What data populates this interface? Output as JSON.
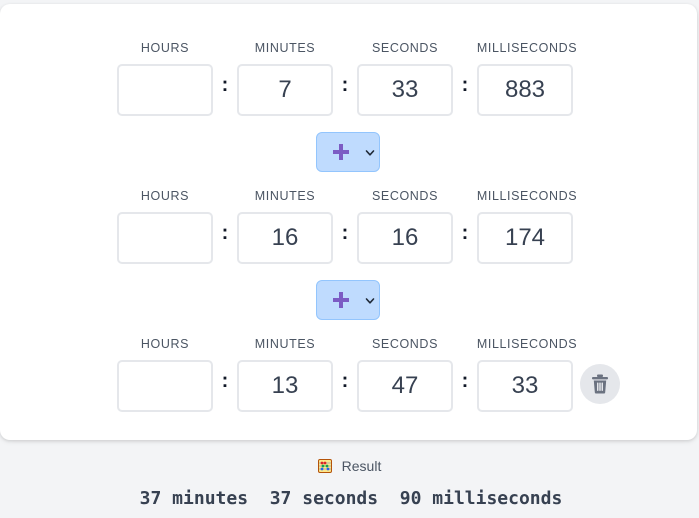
{
  "rows": [
    {
      "labels": {
        "hours": "HOURS",
        "minutes": "MINUTES",
        "seconds": "SECONDS",
        "milliseconds": "MILLISECONDS"
      },
      "values": {
        "hours": "",
        "minutes": "7",
        "seconds": "33",
        "milliseconds": "883"
      }
    },
    {
      "labels": {
        "hours": "HOURS",
        "minutes": "MINUTES",
        "seconds": "SECONDS",
        "milliseconds": "MILLISECONDS"
      },
      "values": {
        "hours": "",
        "minutes": "16",
        "seconds": "16",
        "milliseconds": "174"
      }
    },
    {
      "labels": {
        "hours": "HOURS",
        "minutes": "MINUTES",
        "seconds": "SECONDS",
        "milliseconds": "MILLISECONDS"
      },
      "values": {
        "hours": "",
        "minutes": "13",
        "seconds": "47",
        "milliseconds": "33"
      }
    }
  ],
  "separator": ":",
  "operators": [
    {
      "icon": "plus-icon",
      "selected": "+"
    },
    {
      "icon": "plus-icon",
      "selected": "+"
    }
  ],
  "delete_icon": "trash-icon",
  "result": {
    "icon": "abacus-icon",
    "label": "Result",
    "value": "37 minutes  37 seconds  90 milliseconds"
  },
  "colors": {
    "operator_bg": "#bfdbfe",
    "operator_icon": "#7c5cc4",
    "page_bg": "#f3f4f6",
    "card_bg": "#ffffff"
  }
}
